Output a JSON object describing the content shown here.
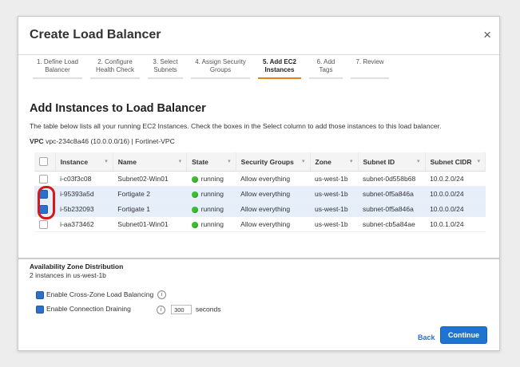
{
  "dialog": {
    "title": "Create Load Balancer",
    "close_glyph": "×"
  },
  "steps": [
    {
      "line1": "1. Define Load",
      "line2": "Balancer",
      "active": false
    },
    {
      "line1": "2. Configure",
      "line2": "Health Check",
      "active": false
    },
    {
      "line1": "3. Select",
      "line2": "Subnets",
      "active": false
    },
    {
      "line1": "4. Assign Security",
      "line2": "Groups",
      "active": false
    },
    {
      "line1": "5. Add EC2",
      "line2": "Instances",
      "active": true
    },
    {
      "line1": "6. Add",
      "line2": "Tags",
      "active": false
    },
    {
      "line1": "7. Review",
      "line2": "",
      "active": false
    }
  ],
  "section": {
    "title": "Add Instances to Load Balancer",
    "description": "The table below lists all your running EC2 Instances. Check the boxes in the Select column to add those instances to this load balancer.",
    "vpc_label": "VPC",
    "vpc_value": "vpc-234c8a46 (10.0.0.0/16) | Fortinet-VPC"
  },
  "table": {
    "headers": [
      "Instance",
      "Name",
      "State",
      "Security Groups",
      "Zone",
      "Subnet ID",
      "Subnet CIDR"
    ],
    "sort_glyph": "▾",
    "rows": [
      {
        "checked": false,
        "instance": "i-c03f3c08",
        "name": "Subnet02-Win01",
        "state": "running",
        "sg": "Allow everything",
        "zone": "us-west-1b",
        "subnet": "subnet-0d558b68",
        "cidr": "10.0.2.0/24"
      },
      {
        "checked": true,
        "instance": "i-95393a5d",
        "name": "Fortigate 2",
        "state": "running",
        "sg": "Allow everything",
        "zone": "us-west-1b",
        "subnet": "subnet-0f5a846a",
        "cidr": "10.0.0.0/24"
      },
      {
        "checked": true,
        "instance": "i-5b232093",
        "name": "Fortigate 1",
        "state": "running",
        "sg": "Allow everything",
        "zone": "us-west-1b",
        "subnet": "subnet-0f5a846a",
        "cidr": "10.0.0.0/24"
      },
      {
        "checked": false,
        "instance": "i-aa373462",
        "name": "Subnet01-Win01",
        "state": "running",
        "sg": "Allow everything",
        "zone": "us-west-1b",
        "subnet": "subnet-cb5a84ae",
        "cidr": "10.0.1.0/24"
      }
    ]
  },
  "az": {
    "title": "Availability Zone Distribution",
    "subtitle": "2 instances in us-west-1b",
    "cross_zone_label": "Enable Cross-Zone Load Balancing",
    "draining_label": "Enable Connection Draining",
    "draining_timeout": "300",
    "draining_unit": "seconds",
    "info_glyph": "i"
  },
  "footer": {
    "back_label": "Back",
    "continue_label": "Continue"
  },
  "colors": {
    "accent": "#1f73d2",
    "active_step": "#e67e22",
    "running": "#3bbf2e",
    "highlight": "#d81818"
  }
}
